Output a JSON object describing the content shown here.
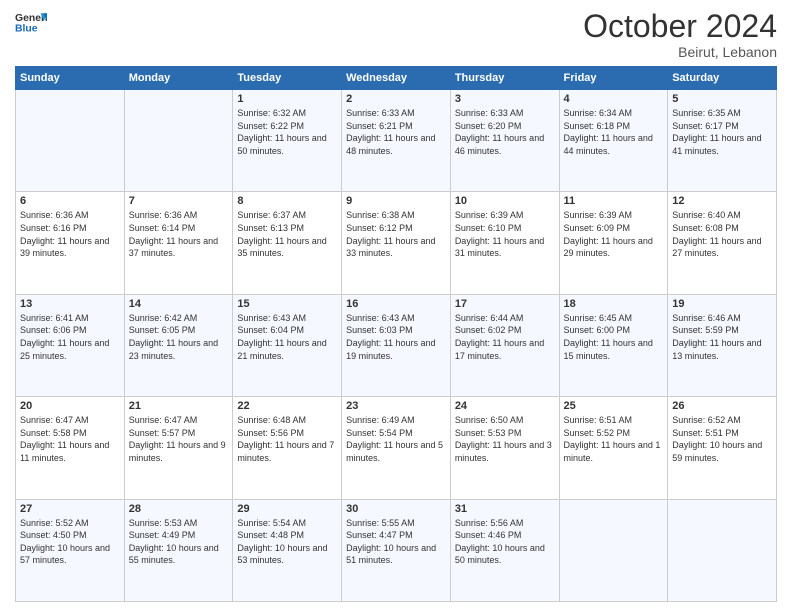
{
  "header": {
    "logo_line1": "General",
    "logo_line2": "Blue",
    "month": "October 2024",
    "location": "Beirut, Lebanon"
  },
  "weekdays": [
    "Sunday",
    "Monday",
    "Tuesday",
    "Wednesday",
    "Thursday",
    "Friday",
    "Saturday"
  ],
  "weeks": [
    [
      {
        "day": "",
        "info": ""
      },
      {
        "day": "",
        "info": ""
      },
      {
        "day": "1",
        "info": "Sunrise: 6:32 AM\nSunset: 6:22 PM\nDaylight: 11 hours and 50 minutes."
      },
      {
        "day": "2",
        "info": "Sunrise: 6:33 AM\nSunset: 6:21 PM\nDaylight: 11 hours and 48 minutes."
      },
      {
        "day": "3",
        "info": "Sunrise: 6:33 AM\nSunset: 6:20 PM\nDaylight: 11 hours and 46 minutes."
      },
      {
        "day": "4",
        "info": "Sunrise: 6:34 AM\nSunset: 6:18 PM\nDaylight: 11 hours and 44 minutes."
      },
      {
        "day": "5",
        "info": "Sunrise: 6:35 AM\nSunset: 6:17 PM\nDaylight: 11 hours and 41 minutes."
      }
    ],
    [
      {
        "day": "6",
        "info": "Sunrise: 6:36 AM\nSunset: 6:16 PM\nDaylight: 11 hours and 39 minutes."
      },
      {
        "day": "7",
        "info": "Sunrise: 6:36 AM\nSunset: 6:14 PM\nDaylight: 11 hours and 37 minutes."
      },
      {
        "day": "8",
        "info": "Sunrise: 6:37 AM\nSunset: 6:13 PM\nDaylight: 11 hours and 35 minutes."
      },
      {
        "day": "9",
        "info": "Sunrise: 6:38 AM\nSunset: 6:12 PM\nDaylight: 11 hours and 33 minutes."
      },
      {
        "day": "10",
        "info": "Sunrise: 6:39 AM\nSunset: 6:10 PM\nDaylight: 11 hours and 31 minutes."
      },
      {
        "day": "11",
        "info": "Sunrise: 6:39 AM\nSunset: 6:09 PM\nDaylight: 11 hours and 29 minutes."
      },
      {
        "day": "12",
        "info": "Sunrise: 6:40 AM\nSunset: 6:08 PM\nDaylight: 11 hours and 27 minutes."
      }
    ],
    [
      {
        "day": "13",
        "info": "Sunrise: 6:41 AM\nSunset: 6:06 PM\nDaylight: 11 hours and 25 minutes."
      },
      {
        "day": "14",
        "info": "Sunrise: 6:42 AM\nSunset: 6:05 PM\nDaylight: 11 hours and 23 minutes."
      },
      {
        "day": "15",
        "info": "Sunrise: 6:43 AM\nSunset: 6:04 PM\nDaylight: 11 hours and 21 minutes."
      },
      {
        "day": "16",
        "info": "Sunrise: 6:43 AM\nSunset: 6:03 PM\nDaylight: 11 hours and 19 minutes."
      },
      {
        "day": "17",
        "info": "Sunrise: 6:44 AM\nSunset: 6:02 PM\nDaylight: 11 hours and 17 minutes."
      },
      {
        "day": "18",
        "info": "Sunrise: 6:45 AM\nSunset: 6:00 PM\nDaylight: 11 hours and 15 minutes."
      },
      {
        "day": "19",
        "info": "Sunrise: 6:46 AM\nSunset: 5:59 PM\nDaylight: 11 hours and 13 minutes."
      }
    ],
    [
      {
        "day": "20",
        "info": "Sunrise: 6:47 AM\nSunset: 5:58 PM\nDaylight: 11 hours and 11 minutes."
      },
      {
        "day": "21",
        "info": "Sunrise: 6:47 AM\nSunset: 5:57 PM\nDaylight: 11 hours and 9 minutes."
      },
      {
        "day": "22",
        "info": "Sunrise: 6:48 AM\nSunset: 5:56 PM\nDaylight: 11 hours and 7 minutes."
      },
      {
        "day": "23",
        "info": "Sunrise: 6:49 AM\nSunset: 5:54 PM\nDaylight: 11 hours and 5 minutes."
      },
      {
        "day": "24",
        "info": "Sunrise: 6:50 AM\nSunset: 5:53 PM\nDaylight: 11 hours and 3 minutes."
      },
      {
        "day": "25",
        "info": "Sunrise: 6:51 AM\nSunset: 5:52 PM\nDaylight: 11 hours and 1 minute."
      },
      {
        "day": "26",
        "info": "Sunrise: 6:52 AM\nSunset: 5:51 PM\nDaylight: 10 hours and 59 minutes."
      }
    ],
    [
      {
        "day": "27",
        "info": "Sunrise: 5:52 AM\nSunset: 4:50 PM\nDaylight: 10 hours and 57 minutes."
      },
      {
        "day": "28",
        "info": "Sunrise: 5:53 AM\nSunset: 4:49 PM\nDaylight: 10 hours and 55 minutes."
      },
      {
        "day": "29",
        "info": "Sunrise: 5:54 AM\nSunset: 4:48 PM\nDaylight: 10 hours and 53 minutes."
      },
      {
        "day": "30",
        "info": "Sunrise: 5:55 AM\nSunset: 4:47 PM\nDaylight: 10 hours and 51 minutes."
      },
      {
        "day": "31",
        "info": "Sunrise: 5:56 AM\nSunset: 4:46 PM\nDaylight: 10 hours and 50 minutes."
      },
      {
        "day": "",
        "info": ""
      },
      {
        "day": "",
        "info": ""
      }
    ]
  ]
}
